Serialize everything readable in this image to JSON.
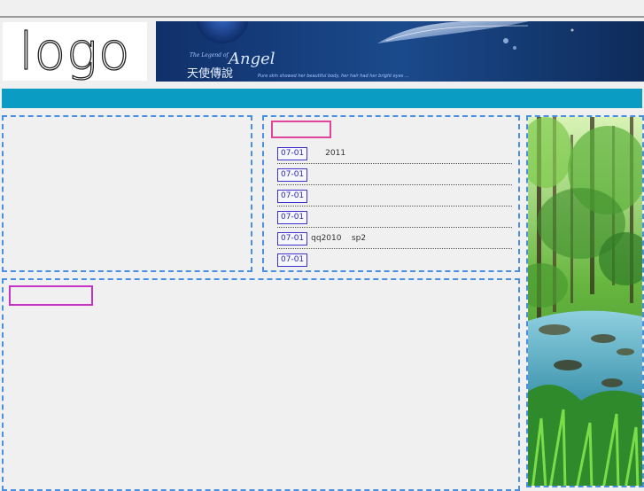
{
  "header": {
    "logo_text": "logo",
    "banner": {
      "script_small": "The Legend of",
      "script_large": "Angel",
      "chinese_title": "天使傳說",
      "tagline": "Pure skin showed her beautiful body, her hair had her bright eyes ..."
    }
  },
  "colors": {
    "nav_bar": "#0b9cc4",
    "panel_border": "#4a90e2",
    "pink_title": "#e0449b",
    "purple_title": "#c733c4",
    "date_badge": "#3d33cc"
  },
  "news_list": [
    {
      "date": "07-01",
      "text": "2011"
    },
    {
      "date": "07-01",
      "text": ""
    },
    {
      "date": "07-01",
      "text": ""
    },
    {
      "date": "07-01",
      "text": ""
    },
    {
      "date": "07-01",
      "text": "qq2010    sp2"
    },
    {
      "date": "07-01",
      "text": ""
    }
  ],
  "sidebar_image": {
    "subject": "forest-stream-photo"
  }
}
